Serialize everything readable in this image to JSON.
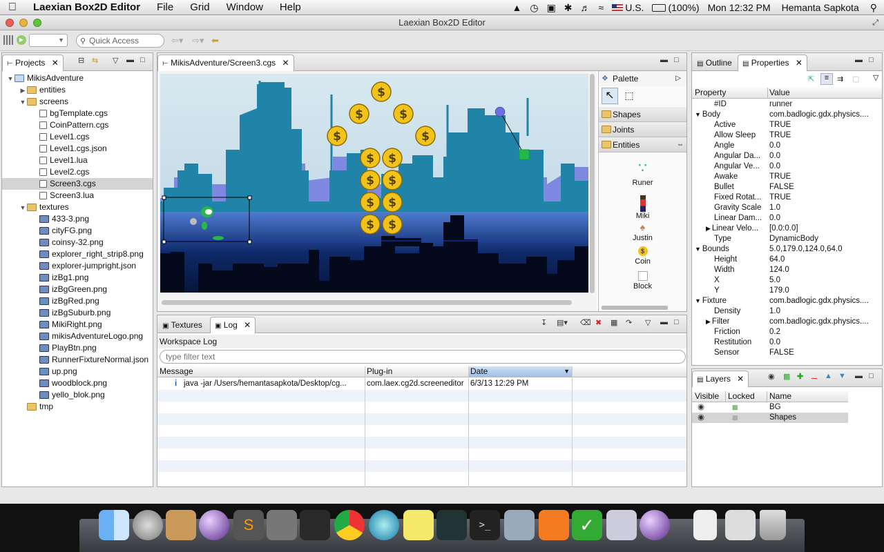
{
  "menubar": {
    "app": "Laexian Box2D Editor",
    "items": [
      "File",
      "Grid",
      "Window",
      "Help"
    ],
    "flag": "U.S.",
    "battery": "(100%)",
    "clock": "Mon 12:32 PM",
    "user": "Hemanta Sapkota"
  },
  "window": {
    "title": "Laexian Box2D Editor"
  },
  "toolbar": {
    "quick_access": "Quick Access"
  },
  "projects": {
    "tab": "Projects",
    "tree": [
      {
        "label": "MikisAdventure",
        "level": 0,
        "twisty": "▼",
        "icon": "project"
      },
      {
        "label": "entities",
        "level": 1,
        "twisty": "▶",
        "icon": "folder"
      },
      {
        "label": "screens",
        "level": 1,
        "twisty": "▼",
        "icon": "folder"
      },
      {
        "label": "bgTemplate.cgs",
        "level": 2,
        "twisty": "",
        "icon": "cgs"
      },
      {
        "label": "CoinPattern.cgs",
        "level": 2,
        "twisty": "",
        "icon": "cgs"
      },
      {
        "label": "Level1.cgs",
        "level": 2,
        "twisty": "",
        "icon": "cgs"
      },
      {
        "label": "Level1.cgs.json",
        "level": 2,
        "twisty": "",
        "icon": "file"
      },
      {
        "label": "Level1.lua",
        "level": 2,
        "twisty": "",
        "icon": "file"
      },
      {
        "label": "Level2.cgs",
        "level": 2,
        "twisty": "",
        "icon": "cgs"
      },
      {
        "label": "Screen3.cgs",
        "level": 2,
        "twisty": "",
        "icon": "cgs",
        "selected": true
      },
      {
        "label": "Screen3.lua",
        "level": 2,
        "twisty": "",
        "icon": "file"
      },
      {
        "label": "textures",
        "level": 1,
        "twisty": "▼",
        "icon": "folder"
      },
      {
        "label": "433-3.png",
        "level": 2,
        "twisty": "",
        "icon": "png"
      },
      {
        "label": "cityFG.png",
        "level": 2,
        "twisty": "",
        "icon": "png"
      },
      {
        "label": "coinsy-32.png",
        "level": 2,
        "twisty": "",
        "icon": "png"
      },
      {
        "label": "explorer_right_strip8.png",
        "level": 2,
        "twisty": "",
        "icon": "png"
      },
      {
        "label": "explorer-jumpright.json",
        "level": 2,
        "twisty": "",
        "icon": "png"
      },
      {
        "label": "izBg1.png",
        "level": 2,
        "twisty": "",
        "icon": "png"
      },
      {
        "label": "izBgGreen.png",
        "level": 2,
        "twisty": "",
        "icon": "png"
      },
      {
        "label": "izBgRed.png",
        "level": 2,
        "twisty": "",
        "icon": "png"
      },
      {
        "label": "izBgSuburb.png",
        "level": 2,
        "twisty": "",
        "icon": "png"
      },
      {
        "label": "MikiRight.png",
        "level": 2,
        "twisty": "",
        "icon": "png"
      },
      {
        "label": "mikisAdventureLogo.png",
        "level": 2,
        "twisty": "",
        "icon": "png"
      },
      {
        "label": "PlayBtn.png",
        "level": 2,
        "twisty": "",
        "icon": "png"
      },
      {
        "label": "RunnerFixtureNormal.json",
        "level": 2,
        "twisty": "",
        "icon": "png"
      },
      {
        "label": "up.png",
        "level": 2,
        "twisty": "",
        "icon": "png"
      },
      {
        "label": "woodblock.png",
        "level": 2,
        "twisty": "",
        "icon": "png"
      },
      {
        "label": "yello_blok.png",
        "level": 2,
        "twisty": "",
        "icon": "png"
      },
      {
        "label": "tmp",
        "level": 1,
        "twisty": "",
        "icon": "folder"
      }
    ]
  },
  "editor": {
    "tab": "MikisAdventure/Screen3.cgs"
  },
  "palette": {
    "title": "Palette",
    "drawers": [
      "Shapes",
      "Joints",
      "Entities"
    ],
    "entities": [
      "Runer",
      "Miki",
      "Justin",
      "Coin",
      "Block"
    ]
  },
  "bottom": {
    "tabs": [
      "Textures",
      "Log"
    ],
    "log_title": "Workspace Log",
    "filter_placeholder": "type filter text",
    "columns": [
      "Message",
      "Plug-in",
      "Date"
    ],
    "rows": [
      {
        "message": "java -jar /Users/hemantasapkota/Desktop/cg...",
        "plugin": "com.laex.cg2d.screeneditor",
        "date": "6/3/13 12:29 PM"
      }
    ]
  },
  "right": {
    "tabs": [
      "Outline",
      "Properties"
    ],
    "columns": [
      "Property",
      "Value"
    ],
    "props": [
      {
        "k": "#ID",
        "v": "runner",
        "level": 1,
        "twisty": ""
      },
      {
        "k": "Body",
        "v": "com.badlogic.gdx.physics....",
        "level": 0,
        "twisty": "▼"
      },
      {
        "k": "Active",
        "v": "TRUE",
        "level": 1,
        "twisty": ""
      },
      {
        "k": "Allow Sleep",
        "v": "TRUE",
        "level": 1,
        "twisty": ""
      },
      {
        "k": "Angle",
        "v": "0.0",
        "level": 1,
        "twisty": ""
      },
      {
        "k": "Angular Da...",
        "v": "0.0",
        "level": 1,
        "twisty": ""
      },
      {
        "k": "Angular Ve...",
        "v": "0.0",
        "level": 1,
        "twisty": ""
      },
      {
        "k": "Awake",
        "v": "TRUE",
        "level": 1,
        "twisty": ""
      },
      {
        "k": "Bullet",
        "v": "FALSE",
        "level": 1,
        "twisty": ""
      },
      {
        "k": "Fixed Rotat...",
        "v": "TRUE",
        "level": 1,
        "twisty": ""
      },
      {
        "k": "Gravity Scale",
        "v": "1.0",
        "level": 1,
        "twisty": ""
      },
      {
        "k": "Linear Dam...",
        "v": "0.0",
        "level": 1,
        "twisty": ""
      },
      {
        "k": "Linear Velo...",
        "v": "[0.0:0.0]",
        "level": 1,
        "twisty": "▶"
      },
      {
        "k": "Type",
        "v": "DynamicBody",
        "level": 1,
        "twisty": ""
      },
      {
        "k": "Bounds",
        "v": "5.0,179.0,124.0,64.0",
        "level": 0,
        "twisty": "▼"
      },
      {
        "k": "Height",
        "v": "64.0",
        "level": 1,
        "twisty": ""
      },
      {
        "k": "Width",
        "v": "124.0",
        "level": 1,
        "twisty": ""
      },
      {
        "k": "X",
        "v": "5.0",
        "level": 1,
        "twisty": ""
      },
      {
        "k": "Y",
        "v": "179.0",
        "level": 1,
        "twisty": ""
      },
      {
        "k": "Fixture",
        "v": "com.badlogic.gdx.physics....",
        "level": 0,
        "twisty": "▼"
      },
      {
        "k": "Density",
        "v": "1.0",
        "level": 1,
        "twisty": ""
      },
      {
        "k": "Filter",
        "v": "com.badlogic.gdx.physics....",
        "level": 1,
        "twisty": "▶"
      },
      {
        "k": "Friction",
        "v": "0.2",
        "level": 1,
        "twisty": ""
      },
      {
        "k": "Restitution",
        "v": "0.0",
        "level": 1,
        "twisty": ""
      },
      {
        "k": "Sensor",
        "v": "FALSE",
        "level": 1,
        "twisty": ""
      }
    ]
  },
  "layers": {
    "tab": "Layers",
    "columns": [
      "Visible",
      "Locked",
      "Name"
    ],
    "rows": [
      {
        "name": "BG"
      },
      {
        "name": "Shapes",
        "selected": true
      }
    ]
  },
  "colors": {
    "sky": "#cfe3ee",
    "city_back": "#7f88e0",
    "city_mid": "#1f84a8",
    "selection": "#d4d4d4",
    "coin": "#f2c318"
  }
}
